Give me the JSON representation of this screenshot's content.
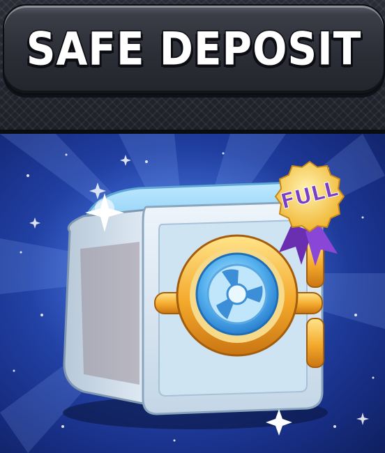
{
  "header": {
    "title": "SAFE DEPOSIT"
  },
  "safe": {
    "badge_label": "FULL",
    "status": "full"
  },
  "colors": {
    "background_blue": "#2648b0",
    "safe_silver": "#d8e6f2",
    "safe_gold": "#f2a62a",
    "badge_gold": "#f3c84a",
    "badge_purple": "#7b3fc4"
  },
  "icons": [
    "safe-icon",
    "full-badge-icon",
    "sparkle-icon"
  ]
}
